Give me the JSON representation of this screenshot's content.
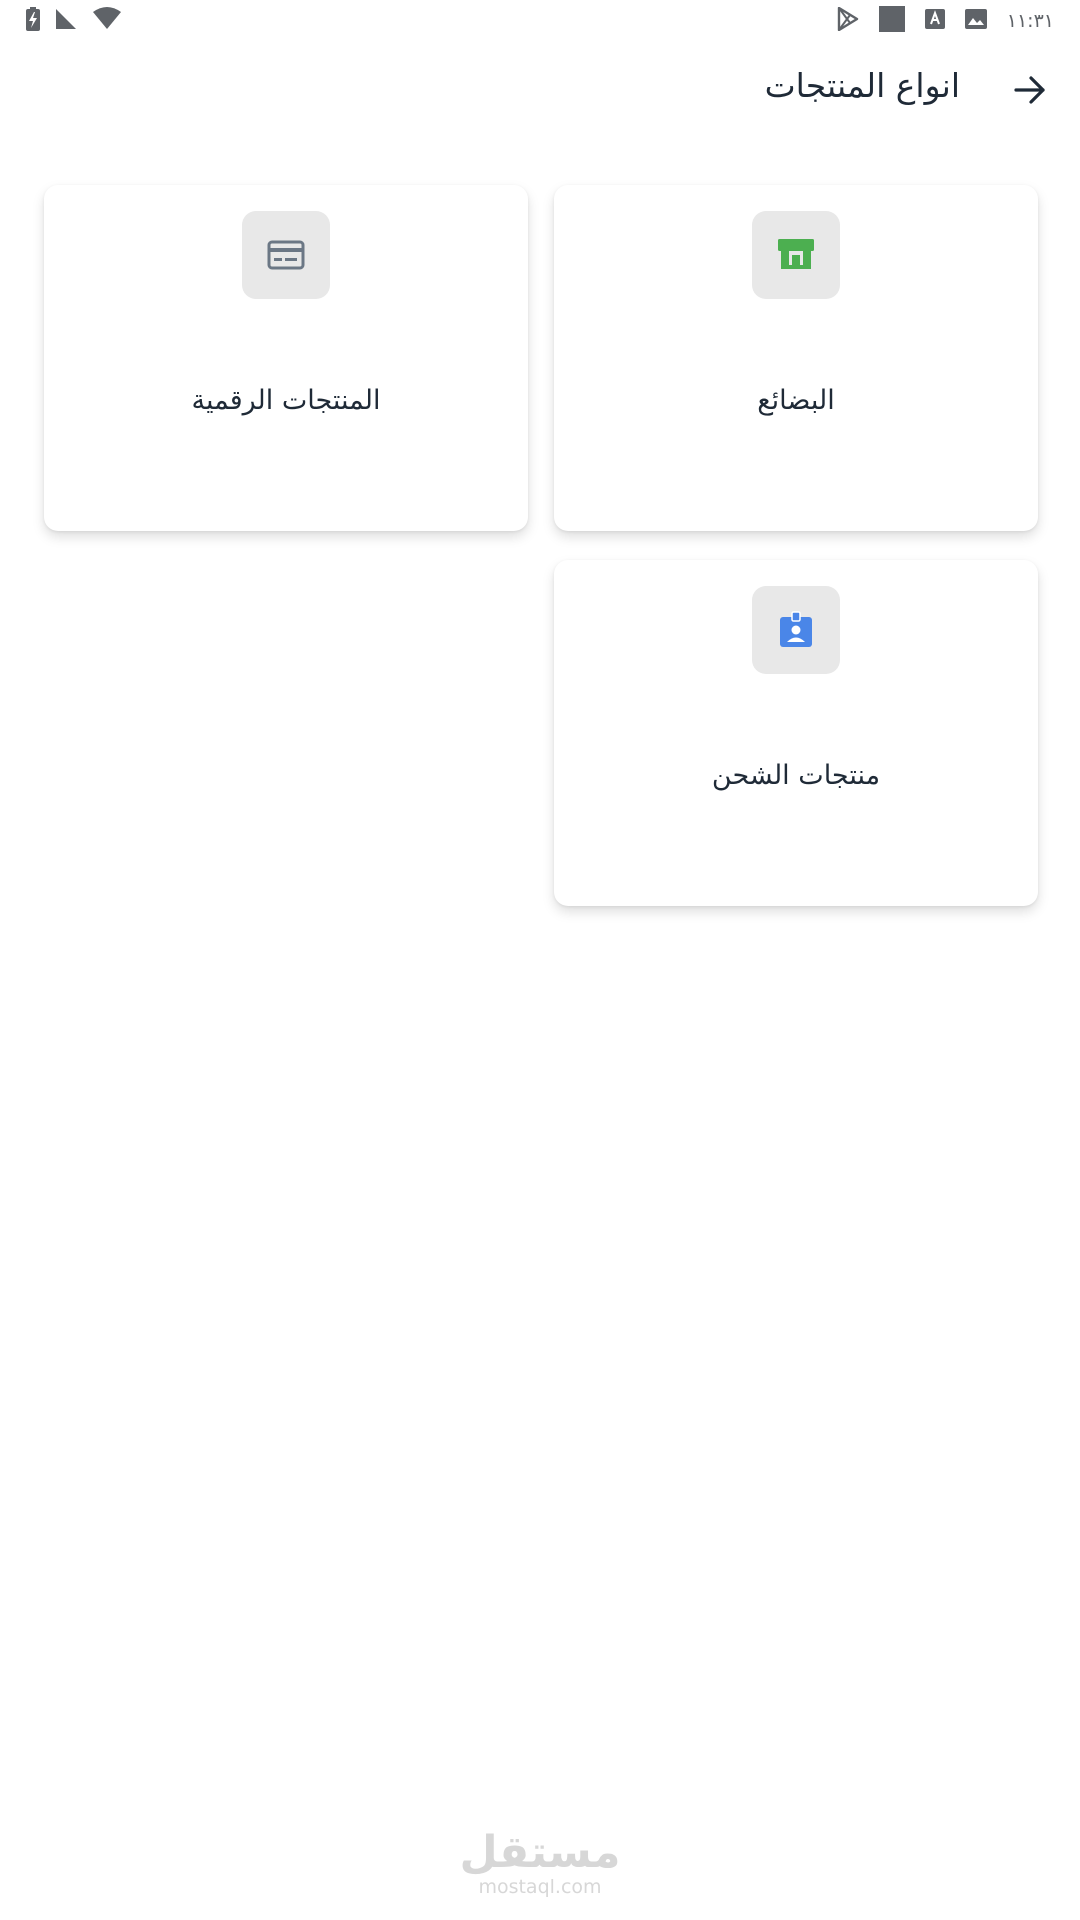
{
  "status_bar": {
    "time": "١١:٣١",
    "icons": [
      "battery-charging-icon",
      "signal-icon",
      "wifi-icon",
      "play-store-icon",
      "square-notification-icon",
      "font-notification-icon",
      "image-notification-icon"
    ]
  },
  "header": {
    "title": "انواع المنتجات",
    "back_icon": "arrow-right-icon"
  },
  "cards": [
    {
      "id": "goods",
      "label": "البضائع",
      "icon": "store-icon",
      "icon_color": "#4caf50"
    },
    {
      "id": "digital",
      "label": "المنتجات الرقمية",
      "icon": "credit-card-icon",
      "icon_color": "#6b7785"
    },
    {
      "id": "shipping",
      "label": "منتجات الشحن",
      "icon": "badge-icon",
      "icon_color": "#4a86e8"
    }
  ],
  "colors": {
    "icon_box_bg": "#e8e8e8",
    "text": "#1f2a37"
  },
  "watermark": {
    "arabic": "مستقل",
    "latin": "mostaql.com"
  }
}
